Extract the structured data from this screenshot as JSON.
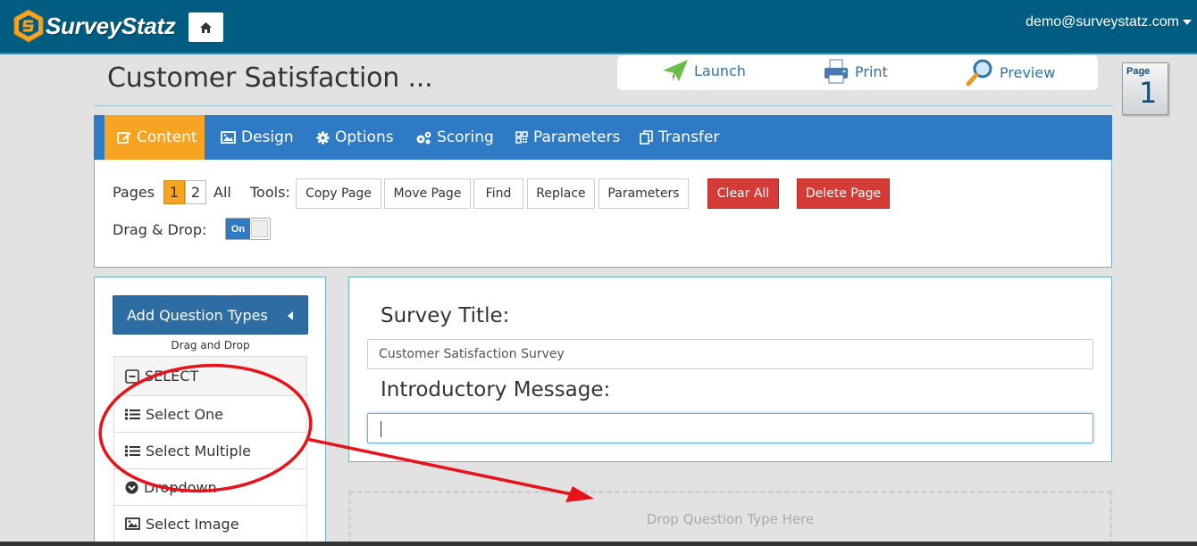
{
  "app": {
    "name": "SurveyStatz",
    "user": "demo@surveystatz.com"
  },
  "page": {
    "title": "Customer Satisfaction ...",
    "badge_label": "Page",
    "badge_number": "1"
  },
  "actions": [
    {
      "label": "Launch",
      "icon": "paper-plane-icon"
    },
    {
      "label": "Print",
      "icon": "printer-icon"
    },
    {
      "label": "Preview",
      "icon": "magnifier-icon"
    }
  ],
  "tabs": [
    {
      "label": "Content",
      "icon": "edit-icon",
      "active": true
    },
    {
      "label": "Design",
      "icon": "image-icon"
    },
    {
      "label": "Options",
      "icon": "gear-icon"
    },
    {
      "label": "Scoring",
      "icon": "gears-icon"
    },
    {
      "label": "Parameters",
      "icon": "qrcode-icon"
    },
    {
      "label": "Transfer",
      "icon": "copy-icon"
    }
  ],
  "tools": {
    "pages_label": "Pages",
    "pages": [
      "1",
      "2"
    ],
    "all_label": "All",
    "tools_label": "Tools:",
    "buttons": [
      "Copy Page",
      "Move Page",
      "Find",
      "Replace",
      "Parameters"
    ],
    "clear_all": "Clear All",
    "delete_page": "Delete Page",
    "drag_drop_label": "Drag & Drop:",
    "toggle_on": "On"
  },
  "sidebar": {
    "add_button": "Add Question Types",
    "hint": "Drag and Drop",
    "group": "SELECT",
    "items": [
      {
        "label": "Select One",
        "icon": "list-icon"
      },
      {
        "label": "Select Multiple",
        "icon": "list-icon"
      },
      {
        "label": "Dropdown",
        "icon": "chevron-circle-down-icon"
      },
      {
        "label": "Select Image",
        "icon": "image-icon"
      }
    ]
  },
  "editor": {
    "survey_title_label": "Survey Title:",
    "survey_title_value": "Customer Satisfaction Survey",
    "intro_label": "Introductory Message:",
    "intro_value": ""
  },
  "drop_zone": "Drop Question Type Here",
  "colors": {
    "header": "#015c82",
    "tab_bar": "#2e7ac4",
    "tab_active": "#f7a422",
    "danger": "#d43a36",
    "annotation": "#e8131a"
  }
}
